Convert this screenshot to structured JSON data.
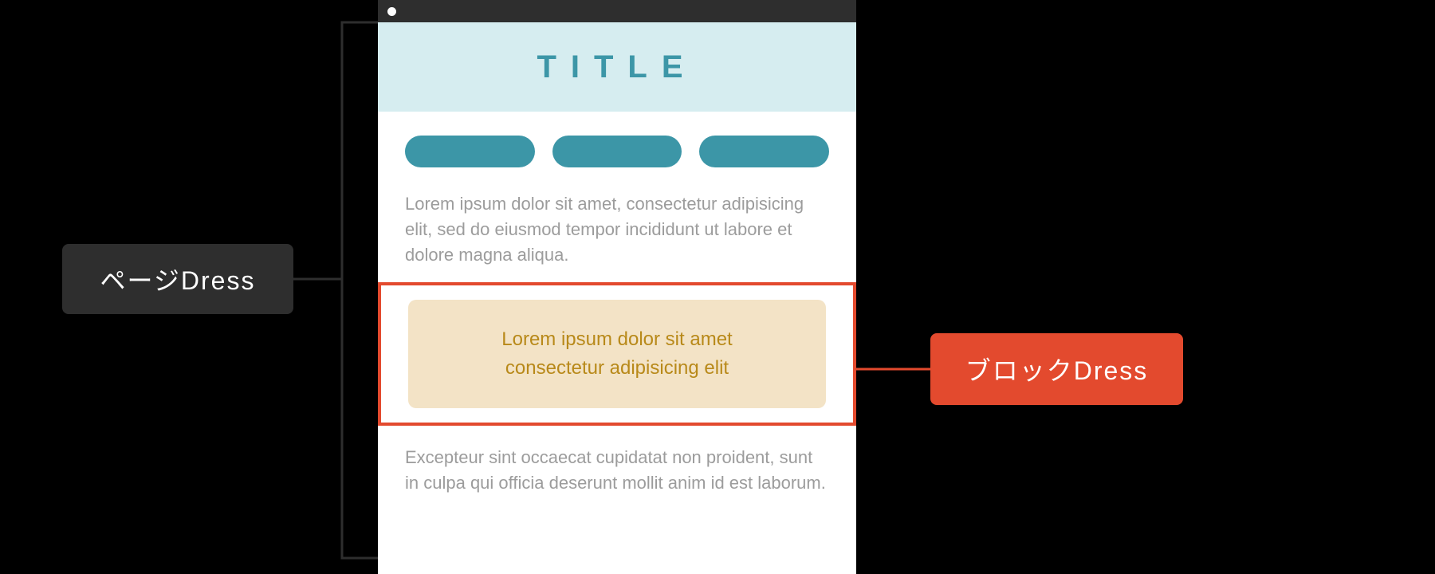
{
  "labels": {
    "page": "ページDress",
    "block": "ブロックDress"
  },
  "mockup": {
    "title": "TITLE",
    "para1": "Lorem ipsum dolor sit amet, consectetur adipisicing elit, sed do eiusmod tempor incididunt ut labore et dolore magna aliqua.",
    "block_line1": "Lorem ipsum dolor sit amet",
    "block_line2": "consectetur adipisicing elit",
    "para2": "Excepteur sint occaecat cupidatat non proident, sunt in culpa qui officia deserunt mollit anim id est laborum."
  }
}
